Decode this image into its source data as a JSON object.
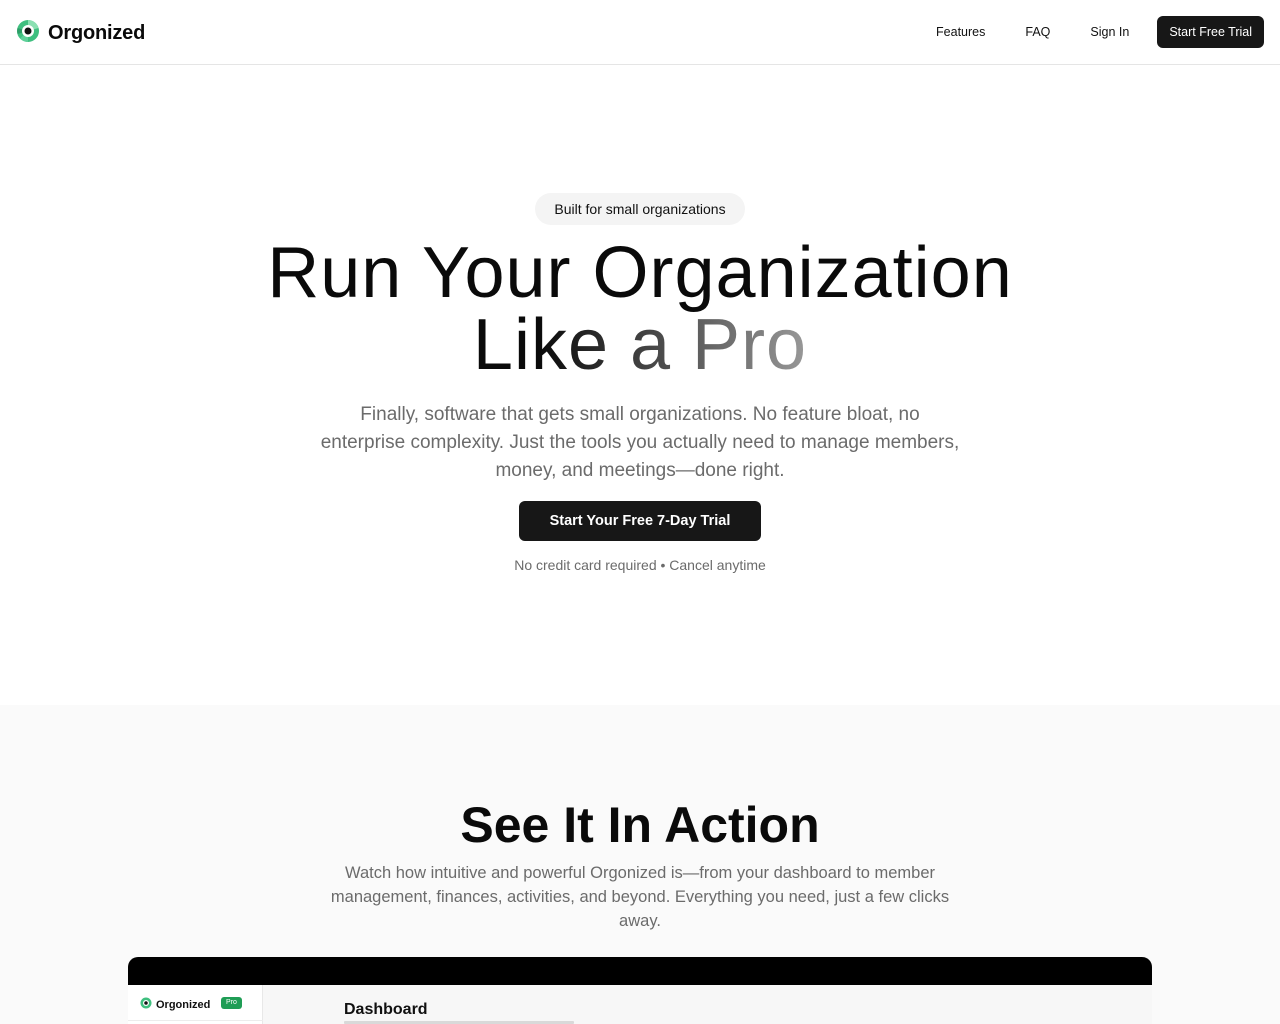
{
  "header": {
    "brand": "Orgonized",
    "nav": {
      "features": "Features",
      "faq": "FAQ",
      "signin": "Sign In",
      "cta": "Start Free Trial"
    }
  },
  "hero": {
    "pill": "Built for small organizations",
    "headline_line1": "Run Your Organization",
    "headline_line2": "Like a Pro",
    "subtitle": "Finally, software that gets small organizations. No feature bloat, no enterprise complexity. Just the tools you actually need to manage members, money, and meetings—done right.",
    "cta": "Start Your Free 7-Day Trial",
    "note": "No credit card required • Cancel anytime"
  },
  "section": {
    "title": "See It In Action",
    "subtitle": "Watch how intuitive and powerful Orgonized is—from your dashboard to member management, finances, activities, and beyond. Everything you need, just a few clicks away."
  },
  "preview": {
    "brand": "Orgonized",
    "badge": "Pro",
    "page_title": "Dashboard"
  },
  "colors": {
    "primary_dark": "#171717",
    "logo_green": "#3fbf7f",
    "badge_green": "#1f9d55",
    "muted_text": "#6b6b6b"
  }
}
